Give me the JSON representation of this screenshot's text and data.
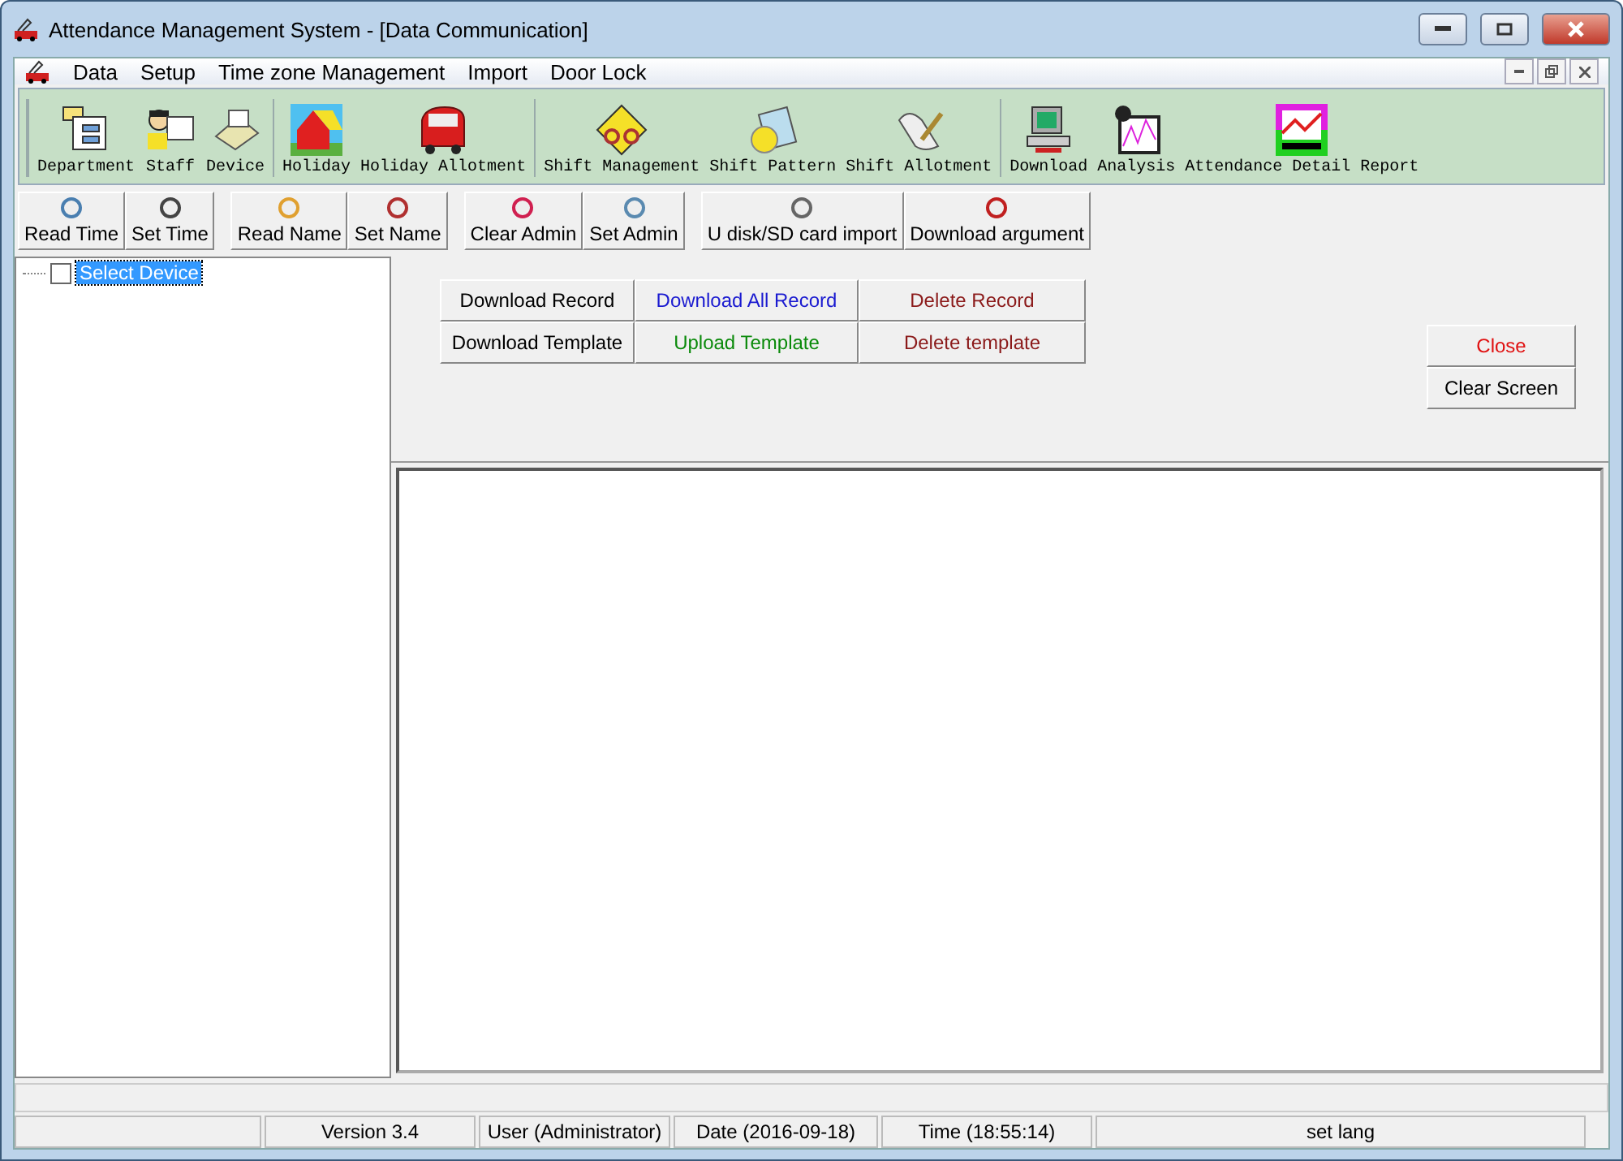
{
  "window": {
    "title": "Attendance Management System - [Data Communication]"
  },
  "menu": [
    "Data",
    "Setup",
    "Time zone Management",
    "Import",
    "Door Lock"
  ],
  "toolbar": [
    [
      {
        "label": "Department",
        "kind": "dept"
      },
      {
        "label": "Staff",
        "kind": "staff"
      },
      {
        "label": "Device",
        "kind": "device"
      }
    ],
    [
      {
        "label": "Holiday",
        "kind": "house"
      },
      {
        "label": "Holiday Allotment",
        "kind": "car"
      }
    ],
    [
      {
        "label": "Shift Management",
        "kind": "bike"
      },
      {
        "label": "Shift Pattern",
        "kind": "pattern"
      },
      {
        "label": "Shift Allotment",
        "kind": "scroll"
      }
    ],
    [
      {
        "label": "Download",
        "kind": "computer"
      },
      {
        "label": "Analysis",
        "kind": "chart"
      },
      {
        "label": "Attendance Detail Report",
        "kind": "report"
      }
    ]
  ],
  "device_buttons": [
    [
      "Read Time",
      "Set Time"
    ],
    [
      "Read Name",
      "Set Name"
    ],
    [
      "Clear Admin",
      "Set Admin"
    ],
    [
      "U disk/SD card import",
      "Download argument"
    ]
  ],
  "tree": {
    "label": "Select Device",
    "checked": false,
    "selected": true
  },
  "actions": [
    {
      "label": "Download Record",
      "color": "#000000"
    },
    {
      "label": "Download All Record",
      "color": "#1a1ad0"
    },
    {
      "label": "Delete Record",
      "color": "#8b1a1a"
    },
    {
      "label": "Download Template",
      "color": "#000000"
    },
    {
      "label": "Upload Template",
      "color": "#0a8a0a"
    },
    {
      "label": "Delete template",
      "color": "#8b1a1a"
    }
  ],
  "side_buttons": [
    {
      "label": "Close",
      "color": "#e01010"
    },
    {
      "label": "Clear Screen",
      "color": "#000000"
    }
  ],
  "status_bar": [
    "Version 3.4",
    "User (Administrator)",
    "Date (2016-09-18)",
    "Time (18:55:14)",
    "set lang"
  ]
}
